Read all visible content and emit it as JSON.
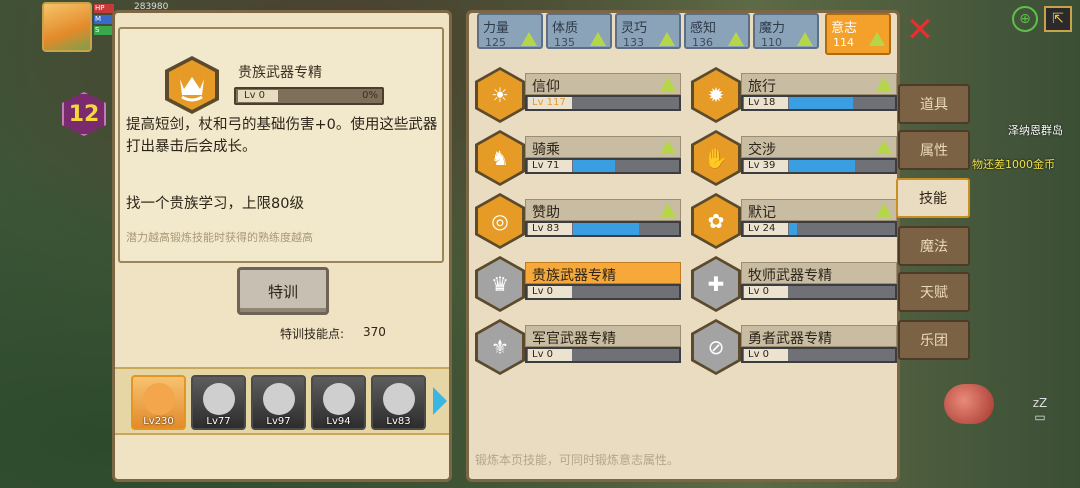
{
  "hud": {
    "hp": "HP",
    "mp": "M",
    "sp": "S",
    "top_num": "283980",
    "side_num": "280",
    "level": "12"
  },
  "map": {
    "location": "泽纳恩群岛",
    "gold_hint": "物还差1000金币"
  },
  "skill_detail": {
    "title": "贵族武器专精",
    "level_label": "Lv 0",
    "progress_pct": "0%",
    "progress_fraction": 0,
    "description": "提高短剑，杖和弓的基础伤害+0。使用这些武器打出暴击后会成长。",
    "study_text": "找一个贵族学习，上限80级",
    "hint": "潜力越高锻炼技能时获得的熟练度越高",
    "train_button": "特训",
    "points_label": "特训技能点:",
    "points_value": "370"
  },
  "heroes": [
    {
      "level": "Lv230",
      "selected": true
    },
    {
      "level": "Lv77",
      "selected": false
    },
    {
      "level": "Lv97",
      "selected": false
    },
    {
      "level": "Lv94",
      "selected": false
    },
    {
      "level": "Lv83",
      "selected": false
    }
  ],
  "attributes": [
    {
      "name": "力量",
      "value": "125"
    },
    {
      "name": "体质",
      "value": "135"
    },
    {
      "name": "灵巧",
      "value": "133"
    },
    {
      "name": "感知",
      "value": "136"
    },
    {
      "name": "魔力",
      "value": "110"
    },
    {
      "name": "意志",
      "value": "114",
      "active": true
    }
  ],
  "skills": [
    {
      "name": "信仰",
      "level": "Lv 117",
      "fill": 0,
      "up": true,
      "icon": "sun-icon",
      "gold": true
    },
    {
      "name": "旅行",
      "level": "Lv 18",
      "fill": 0.6,
      "up": true,
      "icon": "wheel-icon"
    },
    {
      "name": "骑乘",
      "level": "Lv 71",
      "fill": 0.4,
      "up": true,
      "icon": "horse-icon"
    },
    {
      "name": "交涉",
      "level": "Lv 39",
      "fill": 0.62,
      "up": true,
      "icon": "handshake-icon"
    },
    {
      "name": "赞助",
      "level": "Lv 83",
      "fill": 0.62,
      "up": true,
      "icon": "coins-icon"
    },
    {
      "name": "默记",
      "level": "Lv 24",
      "fill": 0.08,
      "up": true,
      "icon": "brain-icon"
    },
    {
      "name": "贵族武器专精",
      "level": "Lv 0",
      "fill": 0,
      "up": false,
      "icon": "crown-icon",
      "active": true
    },
    {
      "name": "牧师武器专精",
      "level": "Lv 0",
      "fill": 0,
      "up": false,
      "icon": "holy-icon"
    },
    {
      "name": "军官武器专精",
      "level": "Lv 0",
      "fill": 0,
      "up": false,
      "icon": "fleur-icon"
    },
    {
      "name": "勇者武器专精",
      "level": "Lv 0",
      "fill": 0,
      "up": false,
      "icon": "shield-slash-icon"
    }
  ],
  "footer": "锻炼本页技能，可同时锻炼意志属性。",
  "side_tabs": [
    {
      "label": "道具"
    },
    {
      "label": "属性"
    },
    {
      "label": "技能",
      "active": true
    },
    {
      "label": "魔法"
    },
    {
      "label": "天赋"
    },
    {
      "label": "乐团"
    }
  ],
  "colors": {
    "accent": "#f4a12c",
    "bar_fill": "#3a9ee2",
    "up_arrow": "#b6d64a",
    "close": "#e82f2f"
  }
}
